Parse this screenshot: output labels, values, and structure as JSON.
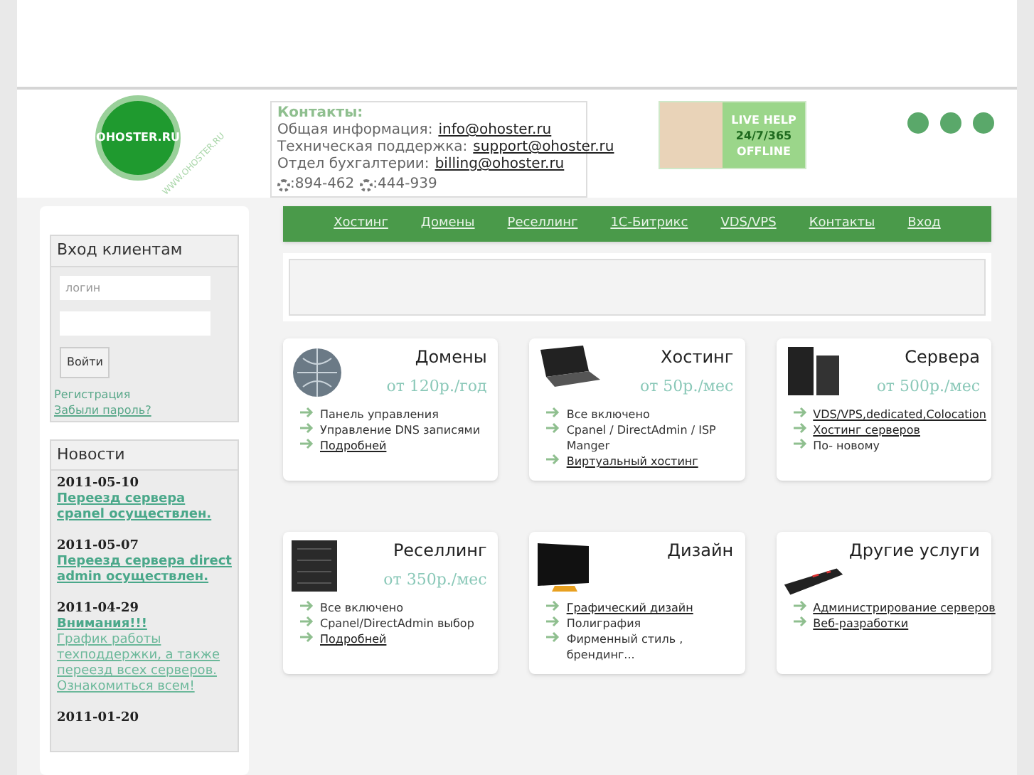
{
  "logo": {
    "text": "OHOSTER.RU",
    "side_text": "WWW.OHOSTER.RU"
  },
  "contacts": {
    "title": "Контакты:",
    "lines": [
      {
        "label": "Общая информация:",
        "link": "info@ohoster.ru"
      },
      {
        "label": "Техническая поддержка:",
        "link": "support@ohoster.ru"
      },
      {
        "label": "Отдел бухгалтерии:",
        "link": "billing@ohoster.ru"
      }
    ],
    "phones": [
      ":894-462",
      ":444-939"
    ]
  },
  "live_help": {
    "line_1": "LIVE HELP",
    "line_2": "24/7/365",
    "status": "OFFLINE"
  },
  "nav": [
    "Хостинг",
    "Домены",
    "Реселлинг",
    "1С-Битрикс",
    "VDS/VPS",
    "Контакты",
    "Вход"
  ],
  "login": {
    "title": "Вход клиентам",
    "login_placeholder": "логин",
    "button": "Войти",
    "register": "Регистрация",
    "forgot": "Забыли пароль?"
  },
  "news": {
    "title": "Новости",
    "items": [
      {
        "date": "2011-05-10",
        "title": "Переезд сервера cpanel осуществлен."
      },
      {
        "date": "2011-05-07",
        "title": "Переезд сервера direct admin осуществлен."
      },
      {
        "date": "2011-04-29",
        "title": "Внимания!!!",
        "text": "График работы техподдержки, а также переезд всех серверов. Ознакомиться всем!"
      },
      {
        "date": "2011-01-20"
      }
    ]
  },
  "services": [
    {
      "kind": "globe",
      "title": "Домены",
      "price": "от 120р./год",
      "items": [
        {
          "text": "Панель управления",
          "kind": "text"
        },
        {
          "text": "Управление DNS записями",
          "kind": "text"
        },
        {
          "text": "Подробней",
          "kind": "link"
        }
      ]
    },
    {
      "kind": "laptop",
      "title": "Хостинг",
      "price": "от 50р./мес",
      "items": [
        {
          "text": "Все включено",
          "kind": "text"
        },
        {
          "text": "Cpanel / DirectAdmin / ISP Manger",
          "kind": "text"
        },
        {
          "text": "Виртуальный хостинг",
          "kind": "link"
        }
      ]
    },
    {
      "kind": "server",
      "title": "Сервера",
      "price": "от 500р./мес",
      "items": [
        {
          "text": "VDS/VPS,dedicated,Colocation",
          "kind": "link"
        },
        {
          "text": "Хостинг серверов",
          "kind": "link"
        },
        {
          "text": "По- новому",
          "kind": "text"
        }
      ]
    },
    {
      "kind": "rack",
      "title": "Реселлинг",
      "price": "от 350р./мес",
      "items": [
        {
          "text": "Все включено",
          "kind": "text"
        },
        {
          "text": "Cpanel/DirectAdmin выбор",
          "kind": "text"
        },
        {
          "text": "Подробней",
          "kind": "link"
        }
      ]
    },
    {
      "kind": "monitor",
      "title": "Дизайн",
      "items": [
        {
          "text": "Графический дизайн",
          "kind": "link"
        },
        {
          "text": "Полиграфия",
          "kind": "text"
        },
        {
          "text": "Фирменный стиль , брендинг...",
          "kind": "text"
        }
      ]
    },
    {
      "kind": "keyboard",
      "title": "Другие услуги",
      "items": [
        {
          "text": "Администрирование серверов",
          "kind": "link"
        },
        {
          "text": "Веб-разработки",
          "kind": "link"
        }
      ]
    }
  ]
}
